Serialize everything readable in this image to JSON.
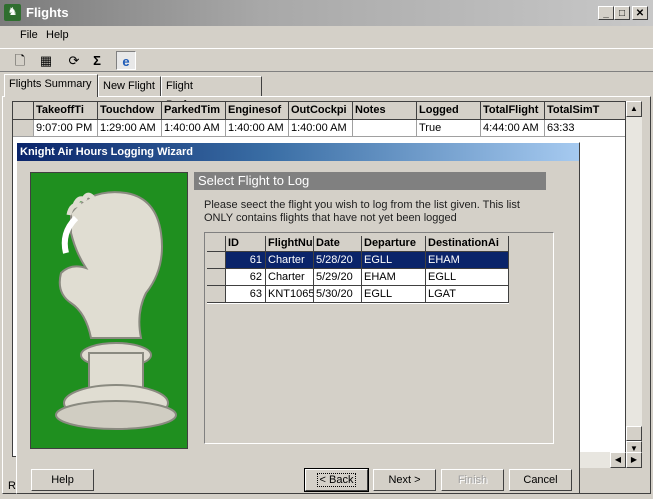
{
  "window": {
    "title": "Flights",
    "icon": "knight-app-icon"
  },
  "window_buttons": [
    "_",
    "□",
    "✕"
  ],
  "menu": [
    "File",
    "Help"
  ],
  "toolbar": [
    "new-document-icon",
    "properties-icon",
    "refresh-icon",
    "sigma-icon",
    "internet-explorer-icon"
  ],
  "tabs": [
    "Flights Summary",
    "New Flight",
    "Flight Performance"
  ],
  "main_grid": {
    "columns": [
      "TakeoffTi",
      "Touchdow",
      "ParkedTim",
      "Enginesof",
      "OutCockpi",
      "Notes",
      "Logged",
      "TotalFlight",
      "TotalSimT"
    ],
    "rows": [
      [
        "9:07:00 PM",
        "1:29:00 AM",
        "1:40:00 AM",
        "1:40:00 AM",
        "1:40:00 AM",
        "",
        "True",
        "4:44:00 AM",
        "63:33"
      ]
    ]
  },
  "status_fragment": "R",
  "wizard": {
    "title": "Knight Air Hours Logging Wizard",
    "step_title": "Select Flight to Log",
    "instructions": [
      "Please seect the flight you wish to log from the list given. This list",
      "ONLY contains flights that have not yet been logged"
    ],
    "grid": {
      "columns": [
        "ID",
        "FlightNu",
        "Date",
        "Departure",
        "DestinationAi"
      ],
      "rows": [
        [
          "61",
          "Charter",
          "5/28/20",
          "EGLL",
          "EHAM"
        ],
        [
          "62",
          "Charter",
          "5/29/20",
          "EHAM",
          "EGLL"
        ],
        [
          "63",
          "KNT1065",
          "5/30/20",
          "EGLL",
          "LGAT"
        ]
      ],
      "selected_row": 0
    },
    "buttons": {
      "help": "Help",
      "back": "< Back",
      "next": "Next >",
      "finish": "Finish",
      "cancel": "Cancel"
    }
  },
  "colors": {
    "selection": "#0a246a",
    "logo_background": "#1f8f1f",
    "step_header": "#808080"
  }
}
